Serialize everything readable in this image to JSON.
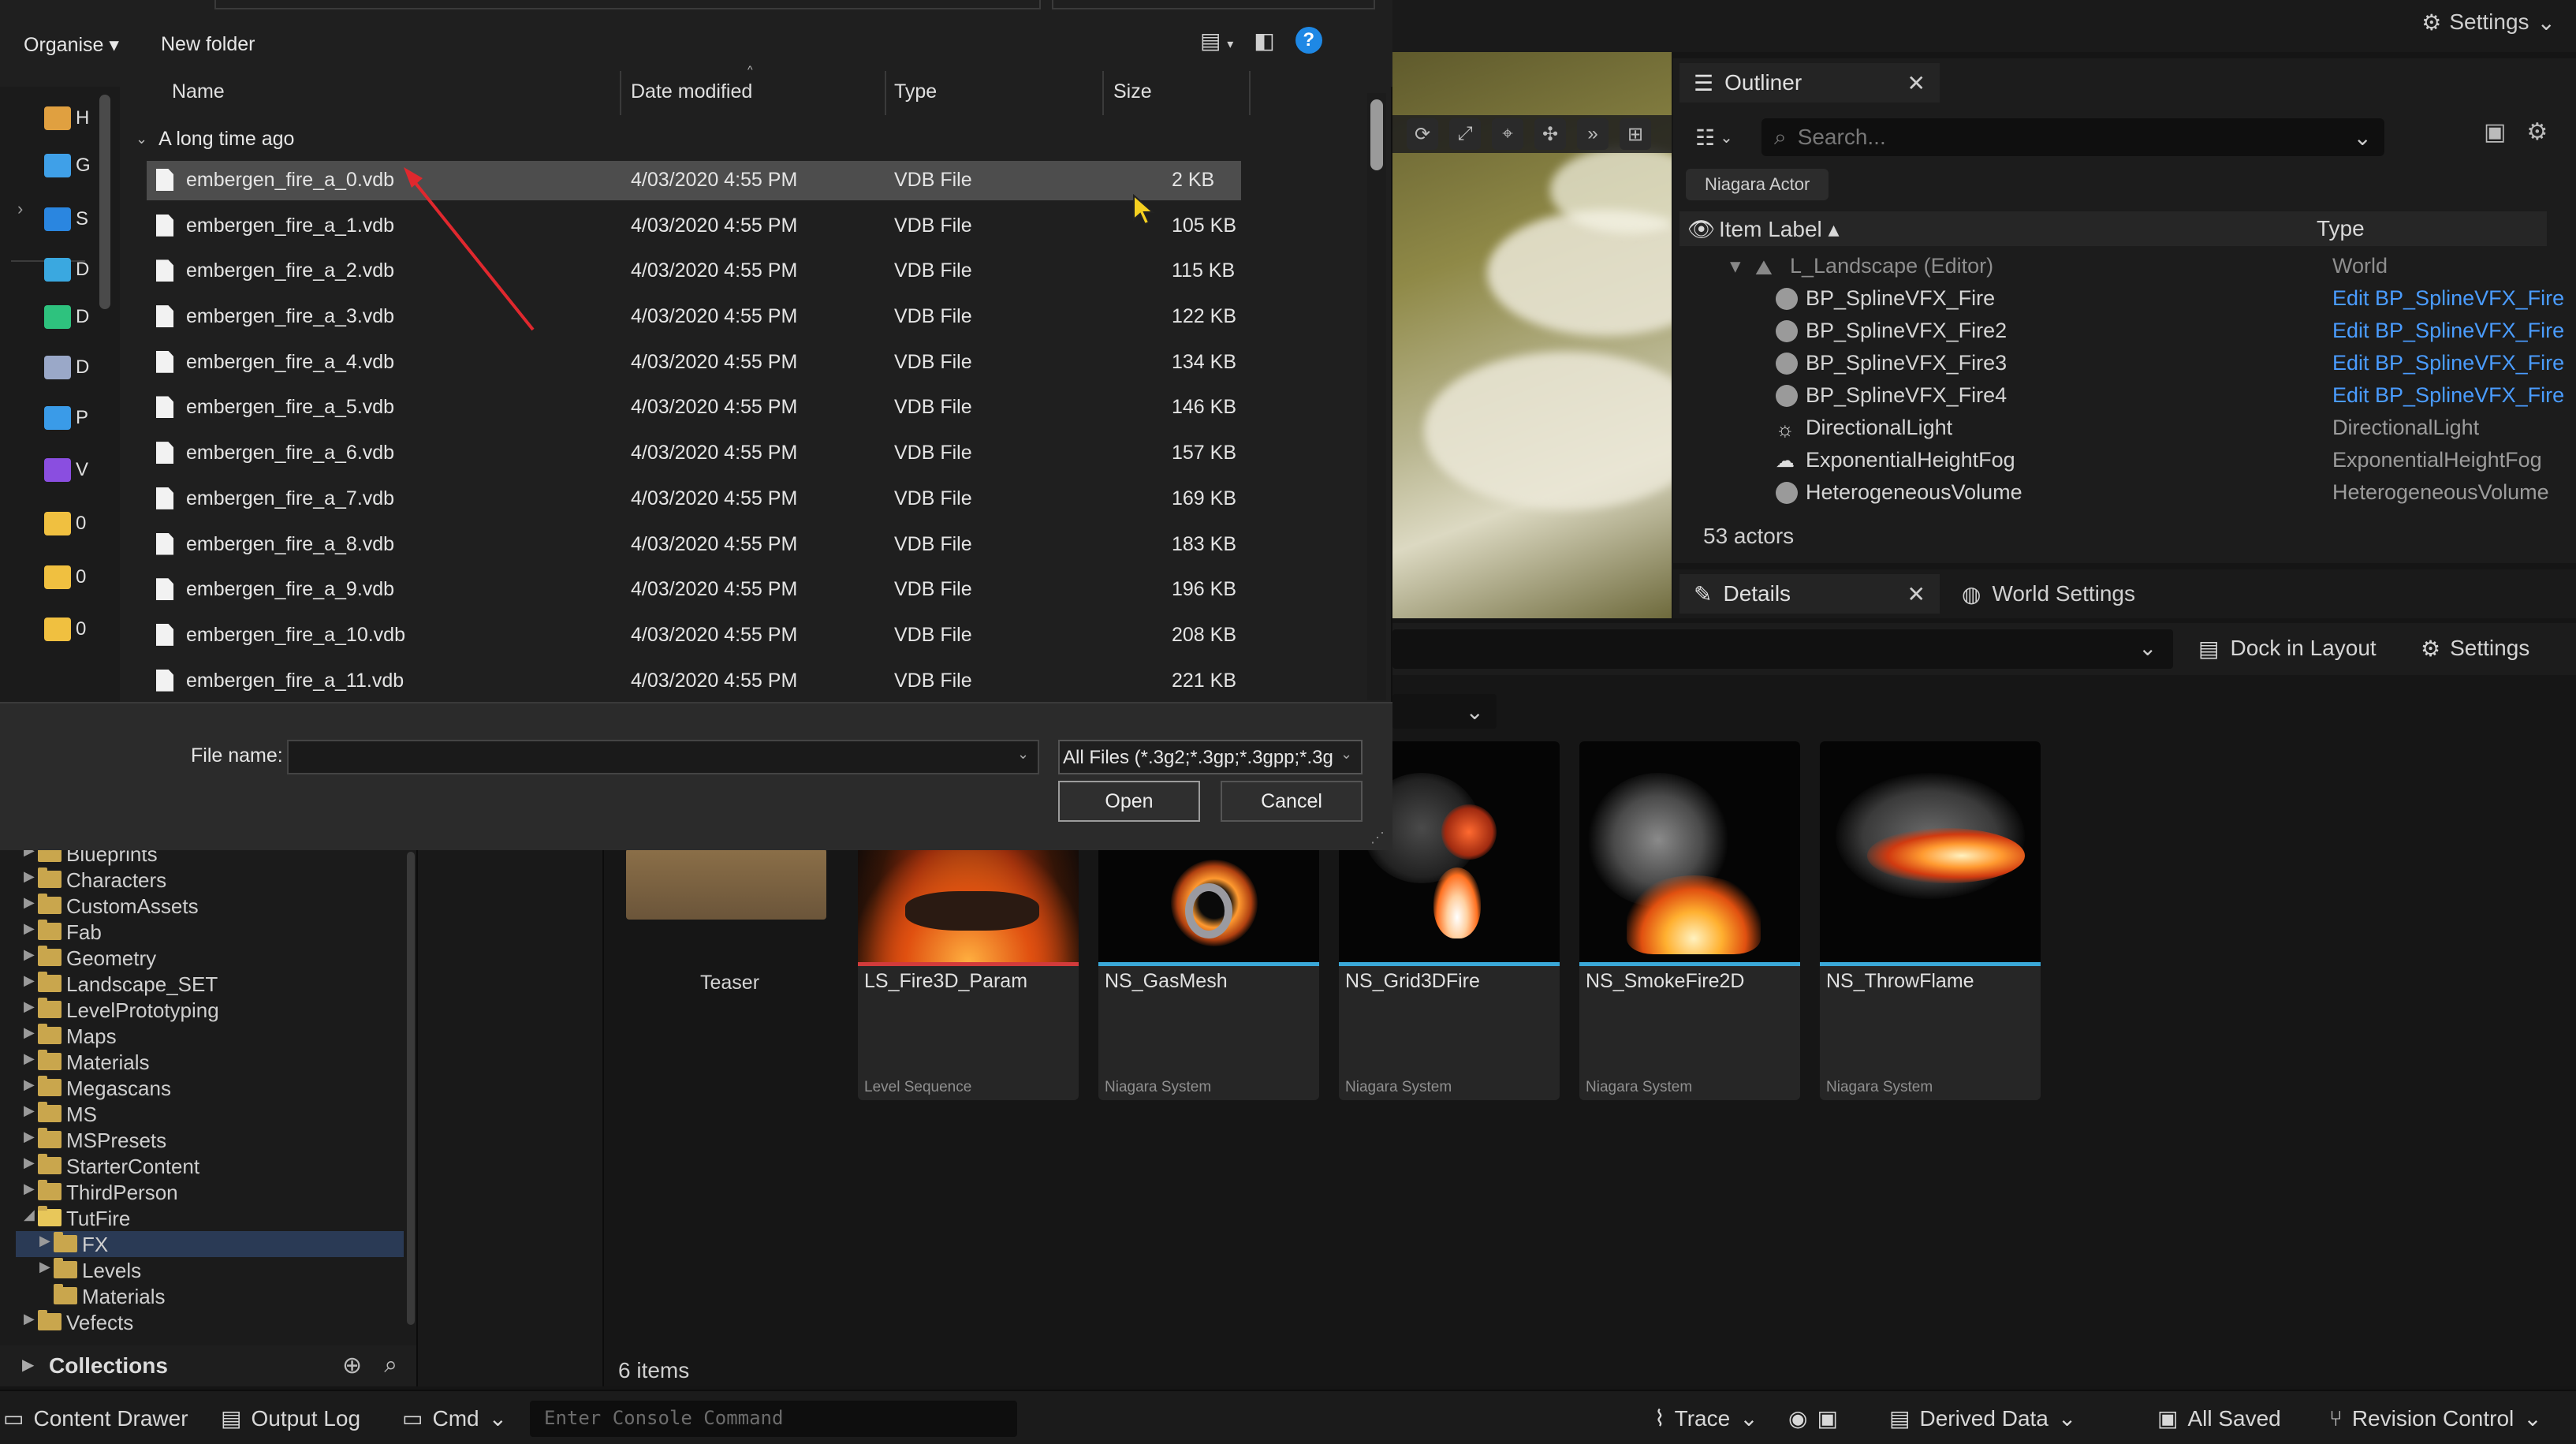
{
  "dialog": {
    "toolbar": {
      "organise": "Organise ▾",
      "new_folder": "New folder"
    },
    "nav_items": [
      {
        "label": "H",
        "icon": "home-icon",
        "color": "#e0a040"
      },
      {
        "label": "G",
        "icon": "gallery-icon",
        "color": "#3fa0e8"
      },
      {
        "label": "S",
        "icon": "onedrive-cloud-icon",
        "color": "#2a86e0"
      },
      {
        "label": "D",
        "icon": "desktop-icon",
        "color": "#3aa8e0"
      },
      {
        "label": "D",
        "icon": "downloads-icon",
        "color": "#2ec27e"
      },
      {
        "label": "D",
        "icon": "documents-icon",
        "color": "#9aa8c8"
      },
      {
        "label": "P",
        "icon": "pictures-icon",
        "color": "#3a9be8"
      },
      {
        "label": "V",
        "icon": "videos-icon",
        "color": "#8a4ee0"
      },
      {
        "label": "0",
        "icon": "folder-icon",
        "color": "#f0c040"
      },
      {
        "label": "0",
        "icon": "folder-icon",
        "color": "#f0c040"
      },
      {
        "label": "0",
        "icon": "folder-icon",
        "color": "#f0c040"
      }
    ],
    "columns": {
      "name": "Name",
      "date": "Date modified",
      "type": "Type",
      "size": "Size"
    },
    "group_label": "A long time ago",
    "files": [
      {
        "name": "embergen_fire_a_0.vdb",
        "date": "4/03/2020 4:55 PM",
        "type": "VDB File",
        "size": "2 KB"
      },
      {
        "name": "embergen_fire_a_1.vdb",
        "date": "4/03/2020 4:55 PM",
        "type": "VDB File",
        "size": "105 KB"
      },
      {
        "name": "embergen_fire_a_2.vdb",
        "date": "4/03/2020 4:55 PM",
        "type": "VDB File",
        "size": "115 KB"
      },
      {
        "name": "embergen_fire_a_3.vdb",
        "date": "4/03/2020 4:55 PM",
        "type": "VDB File",
        "size": "122 KB"
      },
      {
        "name": "embergen_fire_a_4.vdb",
        "date": "4/03/2020 4:55 PM",
        "type": "VDB File",
        "size": "134 KB"
      },
      {
        "name": "embergen_fire_a_5.vdb",
        "date": "4/03/2020 4:55 PM",
        "type": "VDB File",
        "size": "146 KB"
      },
      {
        "name": "embergen_fire_a_6.vdb",
        "date": "4/03/2020 4:55 PM",
        "type": "VDB File",
        "size": "157 KB"
      },
      {
        "name": "embergen_fire_a_7.vdb",
        "date": "4/03/2020 4:55 PM",
        "type": "VDB File",
        "size": "169 KB"
      },
      {
        "name": "embergen_fire_a_8.vdb",
        "date": "4/03/2020 4:55 PM",
        "type": "VDB File",
        "size": "183 KB"
      },
      {
        "name": "embergen_fire_a_9.vdb",
        "date": "4/03/2020 4:55 PM",
        "type": "VDB File",
        "size": "196 KB"
      },
      {
        "name": "embergen_fire_a_10.vdb",
        "date": "4/03/2020 4:55 PM",
        "type": "VDB File",
        "size": "208 KB"
      },
      {
        "name": "embergen_fire_a_11.vdb",
        "date": "4/03/2020 4:55 PM",
        "type": "VDB File",
        "size": "221 KB"
      }
    ],
    "file_name_label": "File name:",
    "file_name_value": "",
    "file_type": "All Files (*.3g2;*.3gp;*.3gpp;*.3g",
    "open_label": "Open",
    "cancel_label": "Cancel"
  },
  "editor": {
    "settings_label": "Settings",
    "outliner": {
      "tab_label": "Outliner",
      "search_placeholder": "Search...",
      "chip": "Niagara Actor",
      "col_label": "Item Label ▴",
      "col_type": "Type",
      "parent": {
        "name": "L_Landscape (Editor)",
        "type": "World"
      },
      "rows": [
        {
          "name": "BP_SplineVFX_Fire",
          "type": "Edit BP_SplineVFX_Fire",
          "link": true
        },
        {
          "name": "BP_SplineVFX_Fire2",
          "type": "Edit BP_SplineVFX_Fire",
          "link": true
        },
        {
          "name": "BP_SplineVFX_Fire3",
          "type": "Edit BP_SplineVFX_Fire",
          "link": true
        },
        {
          "name": "BP_SplineVFX_Fire4",
          "type": "Edit BP_SplineVFX_Fire",
          "link": true
        },
        {
          "name": "DirectionalLight",
          "type": "DirectionalLight",
          "link": false
        },
        {
          "name": "ExponentialHeightFog",
          "type": "ExponentialHeightFog",
          "link": false
        },
        {
          "name": "HeterogeneousVolume",
          "type": "HeterogeneousVolume",
          "link": false
        }
      ],
      "actor_count": "53 actors"
    },
    "details": {
      "tab_label": "Details",
      "world_settings_label": "World Settings",
      "dock_label": "Dock in Layout",
      "settings_label": "Settings"
    },
    "content_tree": [
      {
        "label": "Blueprints",
        "depth": 0,
        "expanded": false,
        "selected": false
      },
      {
        "label": "Characters",
        "depth": 0,
        "expanded": false,
        "selected": false
      },
      {
        "label": "CustomAssets",
        "depth": 0,
        "expanded": false,
        "selected": false
      },
      {
        "label": "Fab",
        "depth": 0,
        "expanded": false,
        "selected": false
      },
      {
        "label": "Geometry",
        "depth": 0,
        "expanded": false,
        "selected": false
      },
      {
        "label": "Landscape_SET",
        "depth": 0,
        "expanded": false,
        "selected": false
      },
      {
        "label": "LevelPrototyping",
        "depth": 0,
        "expanded": false,
        "selected": false
      },
      {
        "label": "Maps",
        "depth": 0,
        "expanded": false,
        "selected": false
      },
      {
        "label": "Materials",
        "depth": 0,
        "expanded": false,
        "selected": false
      },
      {
        "label": "Megascans",
        "depth": 0,
        "expanded": false,
        "selected": false
      },
      {
        "label": "MS",
        "depth": 0,
        "expanded": false,
        "selected": false
      },
      {
        "label": "MSPresets",
        "depth": 0,
        "expanded": false,
        "selected": false
      },
      {
        "label": "StarterContent",
        "depth": 0,
        "expanded": false,
        "selected": false
      },
      {
        "label": "ThirdPerson",
        "depth": 0,
        "expanded": false,
        "selected": false
      },
      {
        "label": "TutFire",
        "depth": 0,
        "expanded": true,
        "selected": false
      },
      {
        "label": "FX",
        "depth": 1,
        "expanded": false,
        "selected": true
      },
      {
        "label": "Levels",
        "depth": 1,
        "expanded": false,
        "selected": false
      },
      {
        "label": "Materials",
        "depth": 1,
        "expanded": false,
        "selected": false,
        "leaf": true
      },
      {
        "label": "Vefects",
        "depth": 0,
        "expanded": false,
        "selected": false
      }
    ],
    "collections_label": "Collections",
    "teaser_label": "Teaser",
    "assets": [
      {
        "name": "LS_Fire3D_Param",
        "type": "Level Sequence",
        "bar": "#d23b3b",
        "thumb": "fire-ground"
      },
      {
        "name": "NS_GasMesh",
        "type": "Niagara System",
        "bar": "#3aa8d8",
        "thumb": "gas-ring"
      },
      {
        "name": "NS_Grid3DFire",
        "type": "Niagara System",
        "bar": "#3aa8d8",
        "thumb": "fireball"
      },
      {
        "name": "NS_SmokeFire2D",
        "type": "Niagara System",
        "bar": "#3aa8d8",
        "thumb": "smoke-fire"
      },
      {
        "name": "NS_ThrowFlame",
        "type": "Niagara System",
        "bar": "#3aa8d8",
        "thumb": "smoke-flame"
      }
    ],
    "item_count": "6 items",
    "statusbar": {
      "content_drawer": "Content Drawer",
      "output_log": "Output Log",
      "cmd": "Cmd",
      "console_placeholder": "Enter Console Command",
      "trace": "Trace",
      "derived_data": "Derived Data",
      "all_saved": "All Saved",
      "revision_control": "Revision Control"
    }
  }
}
